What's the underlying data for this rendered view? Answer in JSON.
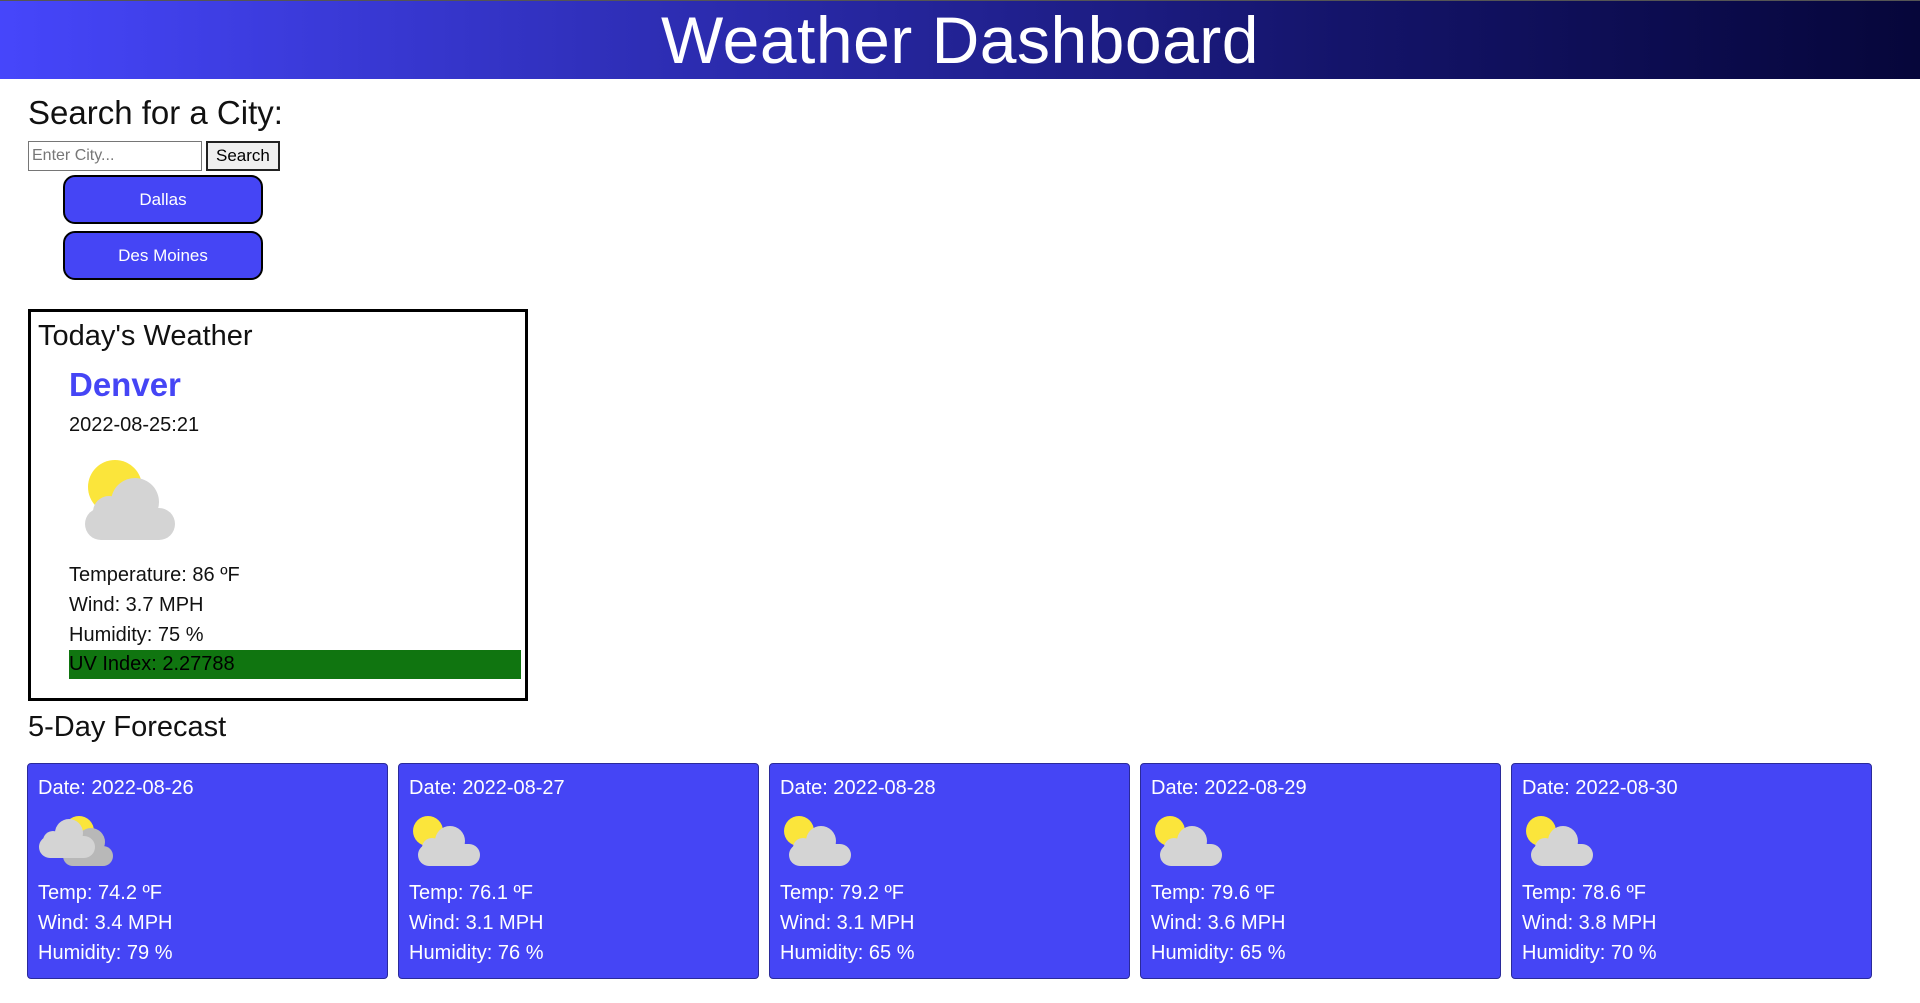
{
  "header": {
    "title": "Weather Dashboard"
  },
  "search": {
    "title": "Search for a City:",
    "placeholder": "Enter City...",
    "button_label": "Search"
  },
  "history": [
    {
      "label": "Dallas"
    },
    {
      "label": "Des Moines"
    }
  ],
  "today": {
    "title": "Today's Weather",
    "city": "Denver",
    "date": "2022-08-25:21",
    "icon": "partly-cloudy-icon",
    "temperature": "Temperature: 86 ºF",
    "wind": "Wind: 3.7 MPH",
    "humidity": "Humidity: 75 %",
    "uv_index": "UV Index: 2.27788",
    "uv_color": "#107510"
  },
  "forecast": {
    "title": "5-Day Forecast",
    "days": [
      {
        "date": "Date: 2022-08-26",
        "icon": "cloudy-sun-behind-icon",
        "temp": "Temp: 74.2 ºF",
        "wind": "Wind: 3.4 MPH",
        "humidity": "Humidity: 79 %"
      },
      {
        "date": "Date: 2022-08-27",
        "icon": "partly-cloudy-icon",
        "temp": "Temp: 76.1 ºF",
        "wind": "Wind: 3.1 MPH",
        "humidity": "Humidity: 76 %"
      },
      {
        "date": "Date: 2022-08-28",
        "icon": "partly-cloudy-icon",
        "temp": "Temp: 79.2 ºF",
        "wind": "Wind: 3.1 MPH",
        "humidity": "Humidity: 65 %"
      },
      {
        "date": "Date: 2022-08-29",
        "icon": "partly-cloudy-icon",
        "temp": "Temp: 79.6 ºF",
        "wind": "Wind: 3.6 MPH",
        "humidity": "Humidity: 65 %"
      },
      {
        "date": "Date: 2022-08-30",
        "icon": "partly-cloudy-icon",
        "temp": "Temp: 78.6 ºF",
        "wind": "Wind: 3.8 MPH",
        "humidity": "Humidity: 70 %"
      }
    ]
  },
  "colors": {
    "accent": "#4545f5",
    "sun": "#fbe53b",
    "cloud": "#d4d4d4"
  }
}
